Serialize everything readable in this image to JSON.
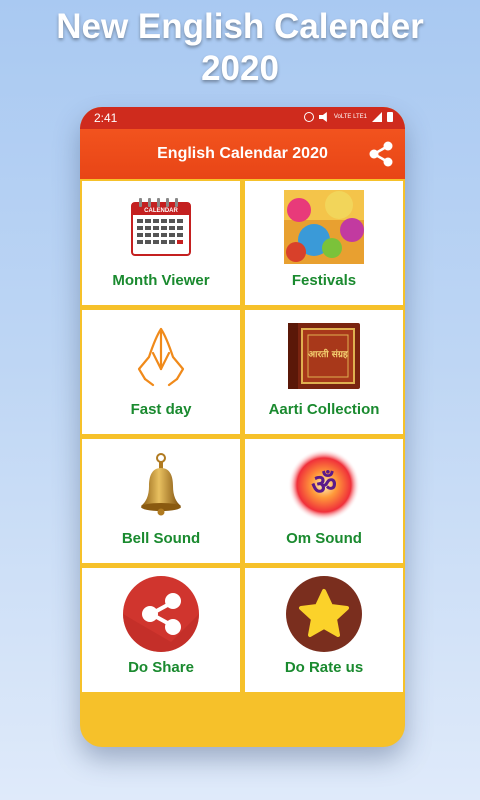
{
  "promo": {
    "title_line1": "New English Calender",
    "title_line2": "2020"
  },
  "status_bar": {
    "time": "2:41",
    "network": "VoLTE LTE1"
  },
  "app_bar": {
    "title": "English Calendar 2020",
    "share_icon": "share-icon"
  },
  "tiles": [
    {
      "label": "Month Viewer",
      "icon": "calendar-icon"
    },
    {
      "label": "Festivals",
      "icon": "festival-image"
    },
    {
      "label": "Fast day",
      "icon": "praying-hands-icon"
    },
    {
      "label": "Aarti Collection",
      "icon": "aarti-book-image"
    },
    {
      "label": "Bell Sound",
      "icon": "bell-icon"
    },
    {
      "label": "Om Sound",
      "icon": "om-icon"
    },
    {
      "label": "Do Share",
      "icon": "share-circle-icon"
    },
    {
      "label": "Do Rate us",
      "icon": "star-circle-icon"
    }
  ],
  "art_text": {
    "calendar_header": "CALENDAR",
    "book_title": "आरती संग्रह",
    "om_symbol": "ॐ"
  },
  "colors": {
    "app_bar": "#e84516",
    "status_bar": "#cf2b1d",
    "panel_background": "#f6c12a",
    "tile_label": "#1a8a2f"
  }
}
